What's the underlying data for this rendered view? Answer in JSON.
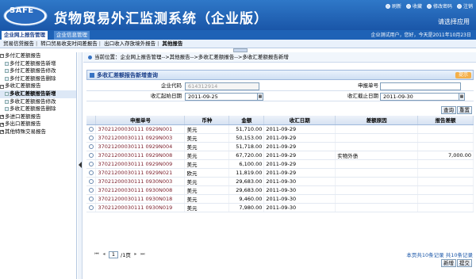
{
  "header": {
    "logo_text": "SAFE",
    "title": "货物贸易外汇监测系统（企业版）",
    "links": [
      "刷新",
      "收藏",
      "修改密码",
      "注销"
    ],
    "choose_app": "请选择应用"
  },
  "tabs": {
    "active": "企业网上报告管理",
    "inactive": "企业信息管理",
    "user_info": "企业测试用户，您好，今天是2011年10月23日"
  },
  "subnav": {
    "items": [
      "贸易信贷报告",
      "转口贸易收支时间差报告",
      "出口收入存放境外报告"
    ],
    "current": "其他报告"
  },
  "sidebar": {
    "items": [
      {
        "label": "多付汇差额报告",
        "type": "group"
      },
      {
        "label": "多付汇差额报告新增",
        "type": "leaf"
      },
      {
        "label": "多付汇差额报告修改",
        "type": "leaf"
      },
      {
        "label": "多付汇差额报告删除",
        "type": "leaf"
      },
      {
        "label": "多收汇差额报告",
        "type": "group"
      },
      {
        "label": "多收汇差额报告新增",
        "type": "leaf",
        "selected": true
      },
      {
        "label": "多收汇差额报告修改",
        "type": "leaf"
      },
      {
        "label": "多收汇差额报告删除",
        "type": "leaf"
      },
      {
        "label": "多进口差额报告",
        "type": "group"
      },
      {
        "label": "多出口差额报告",
        "type": "group"
      },
      {
        "label": "其他特殊交易报告",
        "type": "group"
      }
    ]
  },
  "breadcrumb": "当前位置：企业网上报告管理-->其他报告-->多收汇差额报告-->多收汇差额报告新增",
  "panel": {
    "title": "多收汇差额报告新增查询",
    "tag": "提示"
  },
  "form": {
    "org_code_label": "企业代码",
    "org_code_value": "614312914",
    "report_no_label": "申报单号",
    "report_no_value": "",
    "start_date_label": "收汇起始日期",
    "start_date_value": "2011-09-25",
    "end_date_label": "收汇截止日期",
    "end_date_value": "2011-09-30",
    "query_button": "查询",
    "reset_button": "重置"
  },
  "table": {
    "headers": [
      "申报单号",
      "币种",
      "金额",
      "收汇日期",
      "差额原因",
      "报告差额"
    ],
    "rows": [
      [
        "37021200030111 0929N001",
        "美元",
        "51,710.00",
        "2011-09-29",
        "",
        ""
      ],
      [
        "37021200030111 0929N003",
        "美元",
        "50,153.00",
        "2011-09-29",
        "",
        ""
      ],
      [
        "37021200030111 0929N004",
        "美元",
        "51,718.00",
        "2011-09-29",
        "",
        ""
      ],
      [
        "37021200030111 0929N008",
        "美元",
        "67,720.00",
        "2011-09-29",
        "实物外债",
        "7,000.00"
      ],
      [
        "37021200030111 0929N009",
        "美元",
        "6,100.00",
        "2011-09-29",
        "",
        ""
      ],
      [
        "37021200030111 0929N021",
        "欧元",
        "11,819.00",
        "2011-09-29",
        "",
        ""
      ],
      [
        "37021200030111 0930N003",
        "美元",
        "29,683.00",
        "2011-09-30",
        "",
        ""
      ],
      [
        "37021200030111 0930N008",
        "美元",
        "29,683.00",
        "2011-09-30",
        "",
        ""
      ],
      [
        "37021200030111 0930N018",
        "美元",
        "9,460.00",
        "2011-09-30",
        "",
        ""
      ],
      [
        "37021200030111 0930N019",
        "美元",
        "7,980.00",
        "2011-09-30",
        "",
        ""
      ]
    ]
  },
  "pager": {
    "page": "1",
    "page_total": "/1页",
    "summary": "本页共10条记录 共10条记录"
  },
  "footer": {
    "add_button": "新增",
    "submit_button": "提交"
  },
  "colors": {
    "header_blue": "#1a56a8",
    "link_code": "#7a1d2a"
  }
}
